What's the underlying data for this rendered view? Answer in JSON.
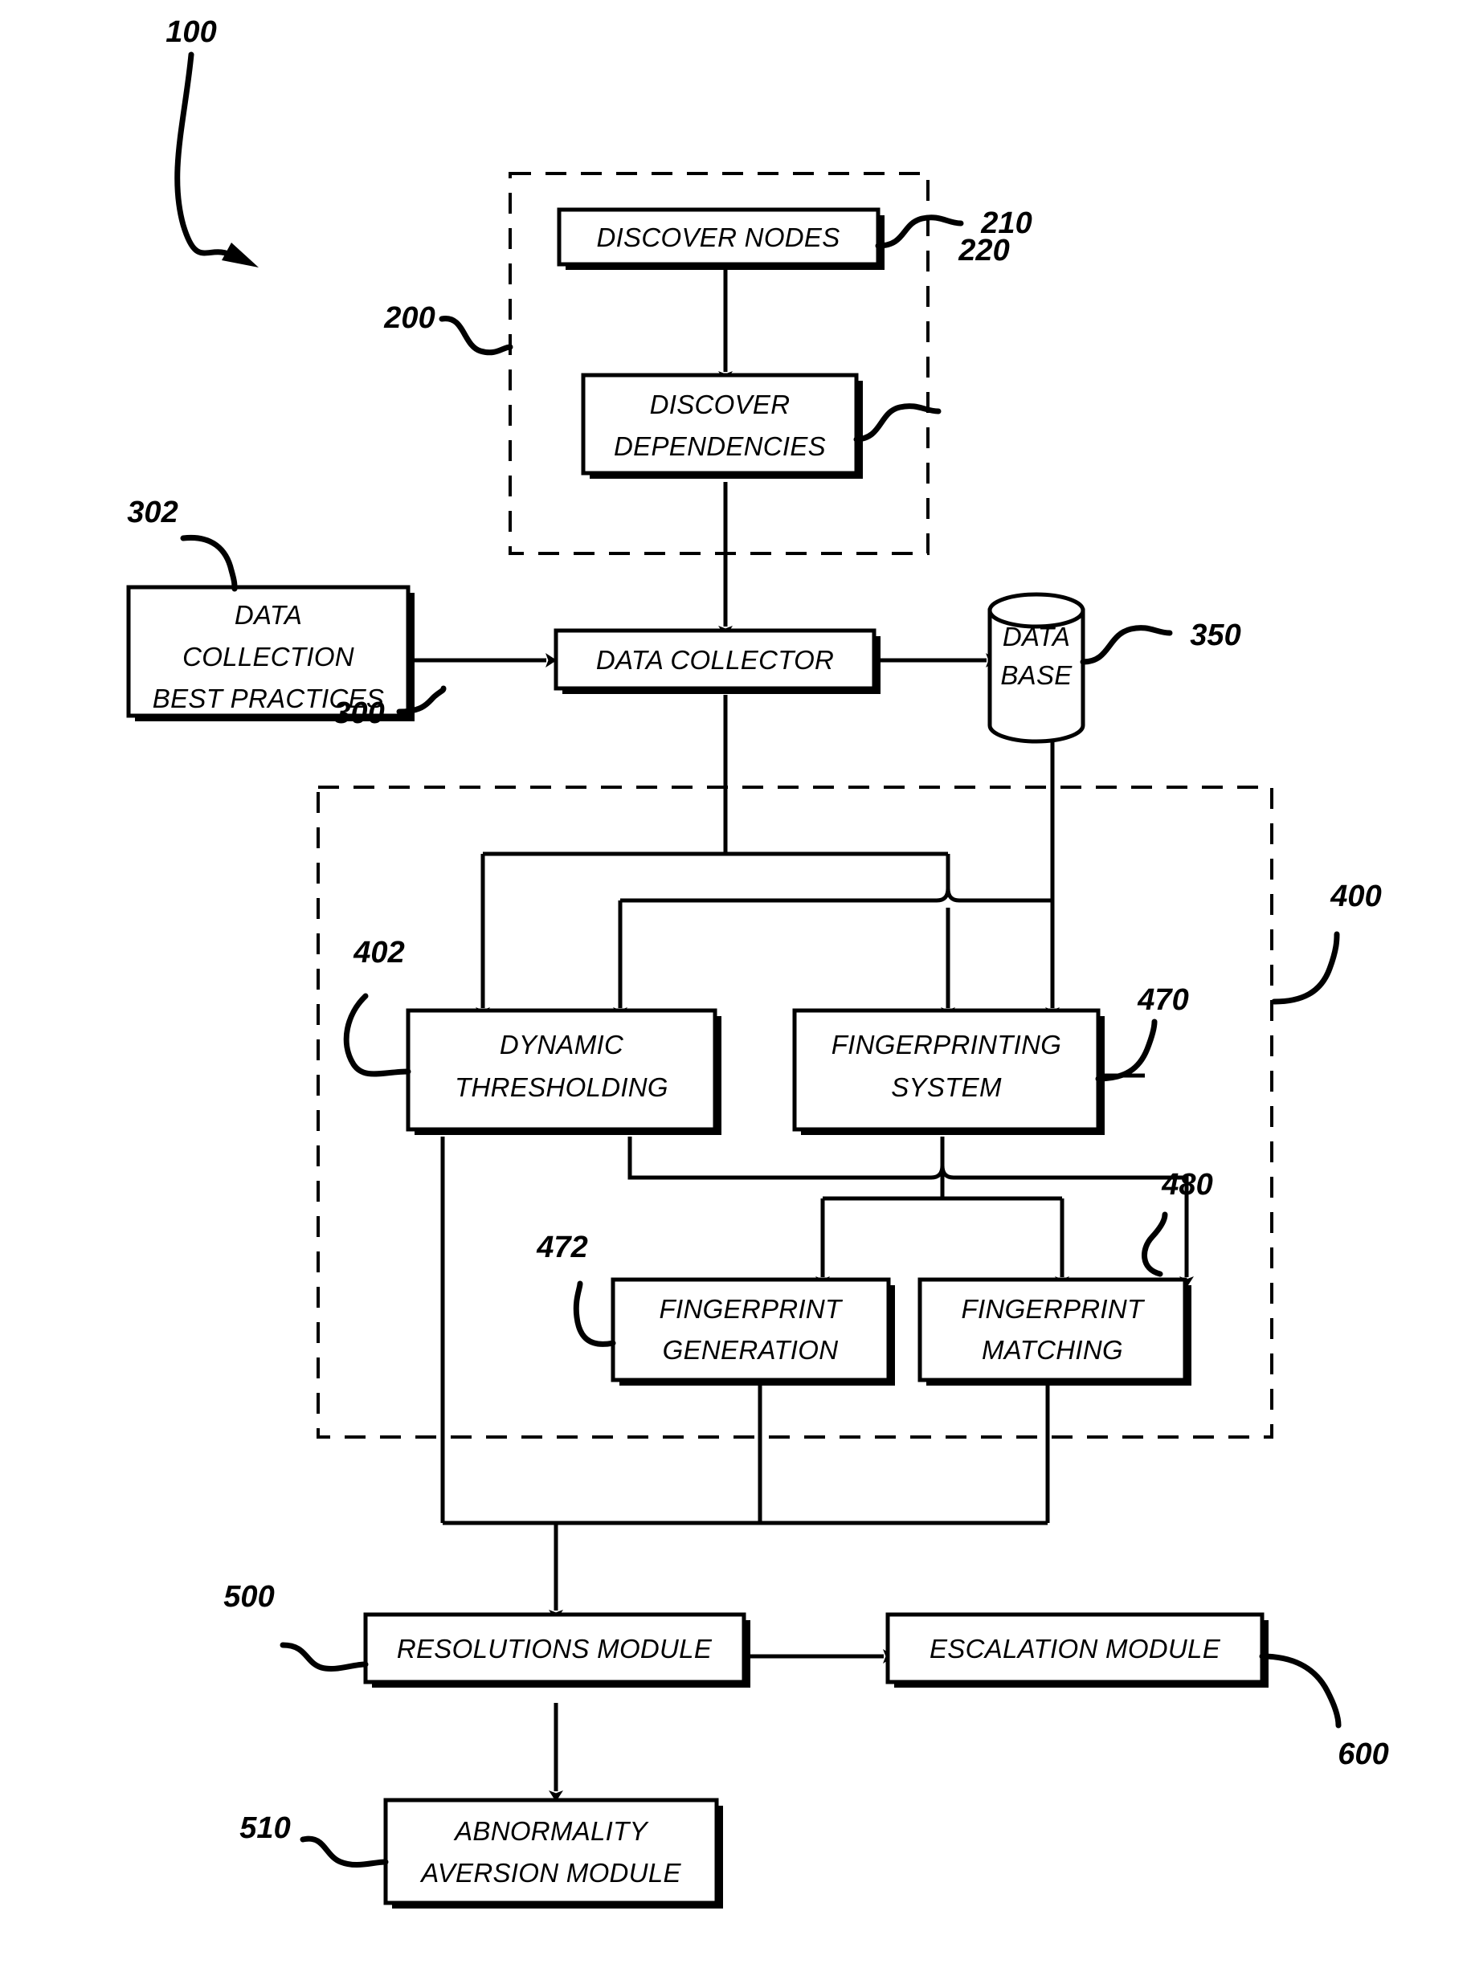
{
  "figure": {
    "title_ref": "100",
    "groups": [
      {
        "id": "g200",
        "ref": "200"
      },
      {
        "id": "g400",
        "ref": "400"
      }
    ],
    "refs": {
      "system": "100",
      "discovery_group": "200",
      "discover_nodes": "210",
      "discover_dependencies": "220",
      "data_collector": "300",
      "best_practices": "302",
      "database": "350",
      "analysis_group": "400",
      "dynamic_thresholding": "402",
      "fingerprinting_system": "470",
      "fingerprint_generation": "472",
      "fingerprint_matching": "480",
      "resolutions_module": "500",
      "abnormality_aversion": "510",
      "escalation_module": "600"
    },
    "nodes": {
      "discover_nodes": {
        "label": "DISCOVER NODES",
        "lines": [
          "DISCOVER NODES"
        ]
      },
      "discover_dependencies": {
        "label": "DISCOVER DEPENDENCIES",
        "lines": [
          "DISCOVER",
          "DEPENDENCIES"
        ]
      },
      "best_practices": {
        "label": "DATA COLLECTION BEST PRACTICES",
        "lines": [
          "DATA",
          "COLLECTION",
          "BEST PRACTICES"
        ]
      },
      "data_collector": {
        "label": "DATA COLLECTOR",
        "lines": [
          "DATA COLLECTOR"
        ]
      },
      "database": {
        "label": "DATA BASE",
        "lines": [
          "DATA",
          "BASE"
        ]
      },
      "dynamic_thresholding": {
        "label": "DYNAMIC THRESHOLDING",
        "lines": [
          "DYNAMIC",
          "THRESHOLDING"
        ]
      },
      "fingerprinting_system": {
        "label": "FINGERPRINTING SYSTEM",
        "lines": [
          "FINGERPRINTING",
          "SYSTEM"
        ]
      },
      "fingerprint_generation": {
        "label": "FINGERPRINT GENERATION",
        "lines": [
          "FINGERPRINT",
          "GENERATION"
        ]
      },
      "fingerprint_matching": {
        "label": "FINGERPRINT MATCHING",
        "lines": [
          "FINGERPRINT",
          "MATCHING"
        ]
      },
      "resolutions_module": {
        "label": "RESOLUTIONS MODULE",
        "lines": [
          "RESOLUTIONS MODULE"
        ]
      },
      "escalation_module": {
        "label": "ESCALATION MODULE",
        "lines": [
          "ESCALATION MODULE"
        ]
      },
      "abnormality_aversion": {
        "label": "ABNORMALITY AVERSION MODULE",
        "lines": [
          "ABNORMALITY",
          "AVERSION MODULE"
        ]
      }
    },
    "colors": {
      "ink": "#000000",
      "paper": "#ffffff"
    }
  }
}
